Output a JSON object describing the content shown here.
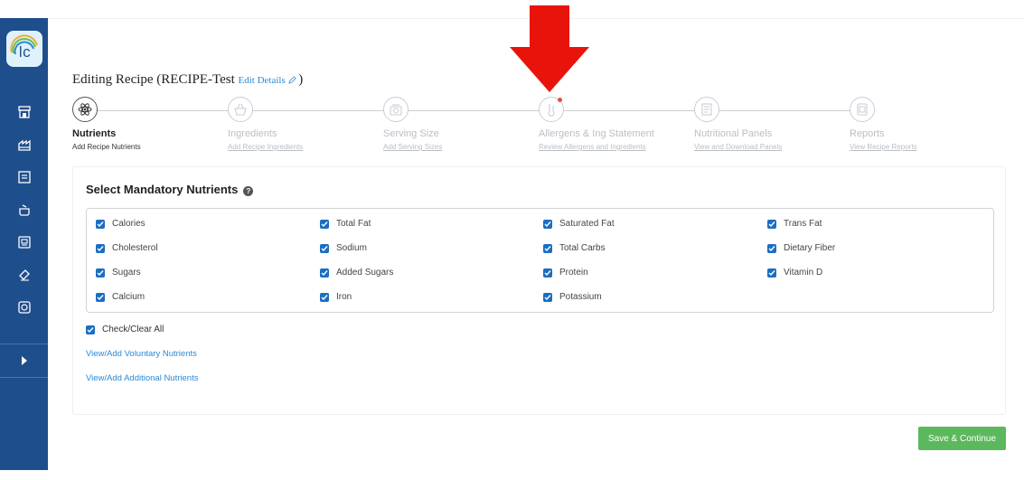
{
  "sidebar": {
    "logo_text": "lc",
    "items": [
      {
        "icon": "store-icon"
      },
      {
        "icon": "factory-icon"
      },
      {
        "icon": "recipe-book-icon"
      },
      {
        "icon": "pot-icon"
      },
      {
        "icon": "label-icon"
      },
      {
        "icon": "tag-icon"
      },
      {
        "icon": "badge-icon"
      }
    ],
    "expand_icon": "chevron-right-icon"
  },
  "header": {
    "title_prefix": "Editing Recipe (RECIPE-Test",
    "edit_link": "Edit Details",
    "title_suffix": ")"
  },
  "steps": [
    {
      "title": "Nutrients",
      "subtitle": "Add Recipe Nutrients",
      "active": true,
      "icon": "atom-icon"
    },
    {
      "title": "Ingredients",
      "subtitle": "Add Recipe Ingredients",
      "active": false,
      "icon": "basket-icon"
    },
    {
      "title": "Serving Size",
      "subtitle": "Add Serving Sizes",
      "active": false,
      "icon": "scale-icon"
    },
    {
      "title": "Allergens & Ing Statement",
      "subtitle": "Review Allergens and Ingredients",
      "active": false,
      "icon": "allergen-icon"
    },
    {
      "title": "Nutritional Panels",
      "subtitle": "View and Download Panels",
      "active": false,
      "icon": "panel-icon"
    },
    {
      "title": "Reports",
      "subtitle": "View Recipe Reports",
      "active": false,
      "icon": "report-icon"
    }
  ],
  "card": {
    "title": "Select Mandatory Nutrients",
    "nutrients": [
      "Calories",
      "Total Fat",
      "Saturated Fat",
      "Trans Fat",
      "Cholesterol",
      "Sodium",
      "Total Carbs",
      "Dietary Fiber",
      "Sugars",
      "Added Sugars",
      "Protein",
      "Vitamin D",
      "Calcium",
      "Iron",
      "Potassium"
    ],
    "check_all": "Check/Clear All",
    "voluntary_link": "View/Add Voluntary Nutrients",
    "additional_link": "View/Add Additional Nutrients"
  },
  "actions": {
    "save": "Save & Continue"
  },
  "colors": {
    "sidebar": "#1f4e8c",
    "checkbox": "#1b6ec2",
    "link": "#2b8ad6",
    "save": "#5cb85c",
    "arrow": "#e8140c"
  }
}
